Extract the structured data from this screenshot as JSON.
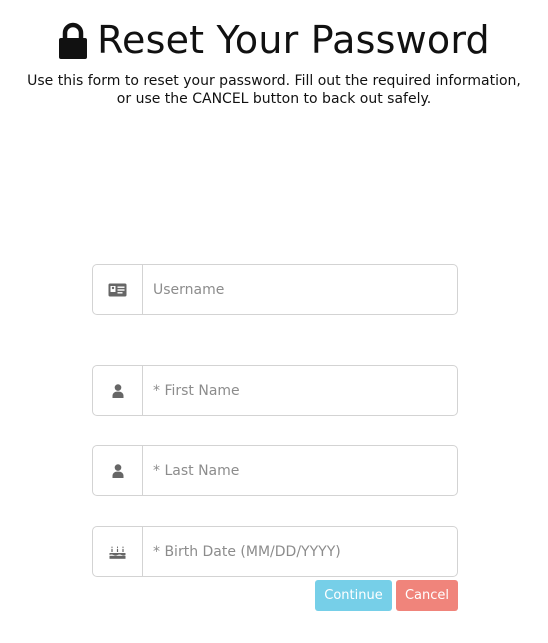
{
  "header": {
    "icon": "lock-icon",
    "title": "Reset Your Password",
    "intro_line1": "Use this form to reset your password. Fill out the required information,",
    "intro_line2": "or use the CANCEL button to back out safely."
  },
  "form": {
    "username": {
      "icon": "id-card-icon",
      "placeholder": "Username",
      "value": ""
    },
    "first_name": {
      "icon": "user-icon",
      "placeholder": "* First Name",
      "value": ""
    },
    "last_name": {
      "icon": "user-icon",
      "placeholder": "* Last Name",
      "value": ""
    },
    "birth_date": {
      "icon": "birthday-cake-icon",
      "placeholder": "* Birth Date (MM/DD/YYYY)",
      "value": ""
    }
  },
  "actions": {
    "continue_label": "Continue",
    "cancel_label": "Cancel"
  },
  "colors": {
    "continue": "#76cfe8",
    "cancel": "#f0847b",
    "border": "#d3d3d3",
    "icon": "#666666"
  }
}
